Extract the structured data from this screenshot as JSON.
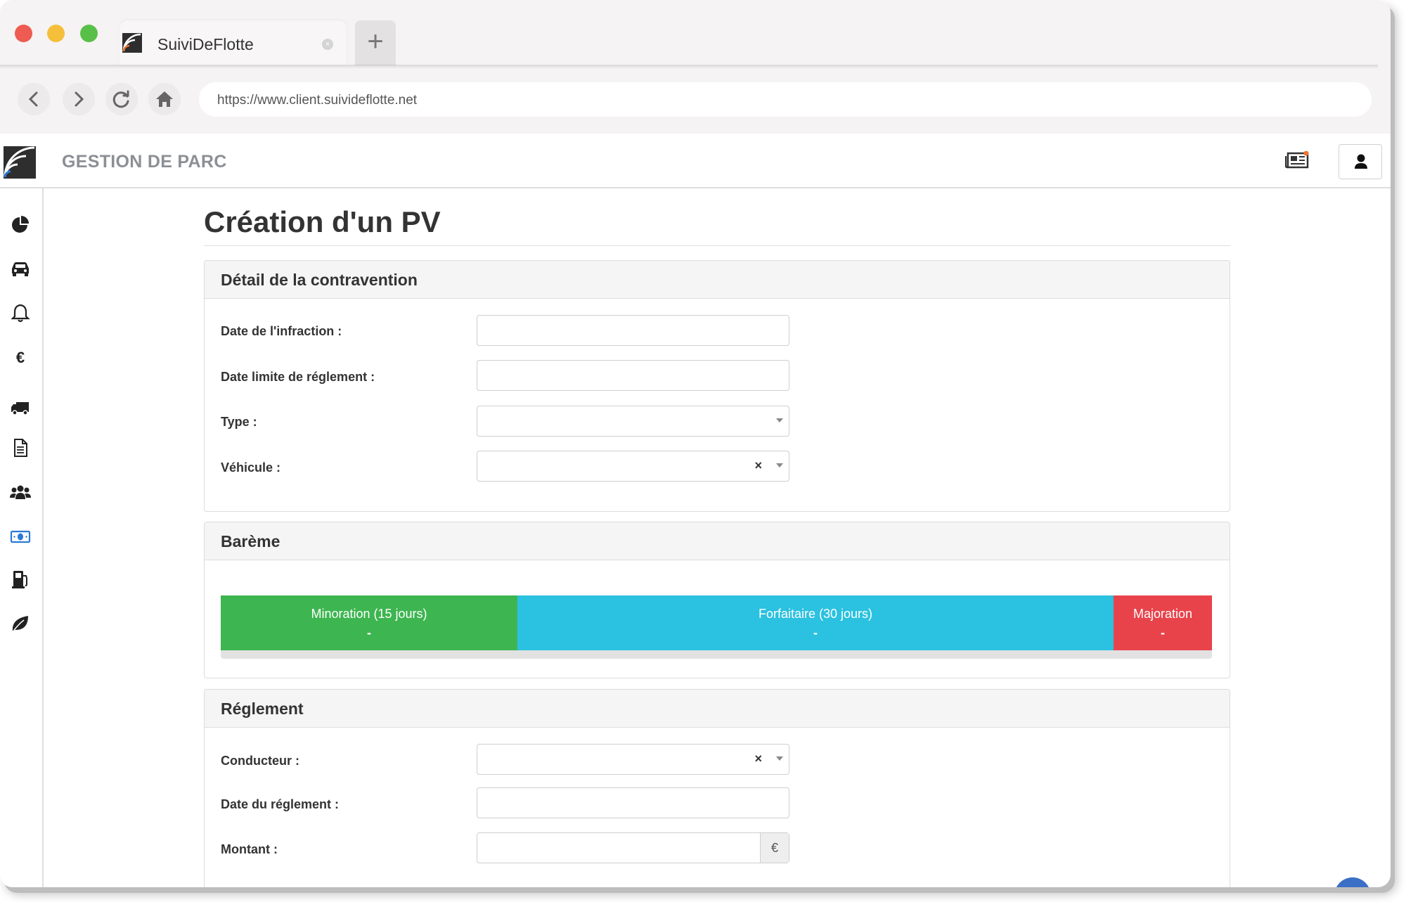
{
  "browser": {
    "tab_title": "SuiviDeFlotte",
    "new_tab_symbol": "+",
    "close_tab_symbol": "×",
    "url": "https://www.client.suivideflotte.net",
    "nav": {
      "back": "‹",
      "forward": "›",
      "reload": "⟳"
    }
  },
  "header": {
    "title": "GESTION DE PARC",
    "accent_color": "#f0742c"
  },
  "sidebar": {
    "icons": [
      "pie-chart-icon",
      "car-icon",
      "bell-icon",
      "euro-icon",
      "truck-icon",
      "document-icon",
      "users-icon",
      "banknote-icon",
      "fuel-pump-icon",
      "leaf-icon"
    ],
    "euro_symbol": "€",
    "active_color": "#2a7ad6"
  },
  "page": {
    "title": "Création d'un PV"
  },
  "detail": {
    "heading": "Détail de la contravention",
    "date_infraction_label": "Date de l'infraction :",
    "date_limite_label": "Date limite de réglement :",
    "type_label": "Type :",
    "vehicule_label": "Véhicule :",
    "clear_symbol": "×"
  },
  "bareme": {
    "heading": "Barème",
    "segments": [
      {
        "label": "Minoration (15 jours)",
        "value": "-",
        "color": "#3db550"
      },
      {
        "label": "Forfaitaire (30 jours)",
        "value": "-",
        "color": "#2bc1e0"
      },
      {
        "label": "Majoration",
        "value": "-",
        "color": "#e8434b"
      }
    ]
  },
  "reglement": {
    "heading": "Réglement",
    "conducteur_label": "Conducteur :",
    "date_reglement_label": "Date du réglement :",
    "montant_label": "Montant :",
    "currency_addon": "€",
    "clear_symbol": "×"
  }
}
